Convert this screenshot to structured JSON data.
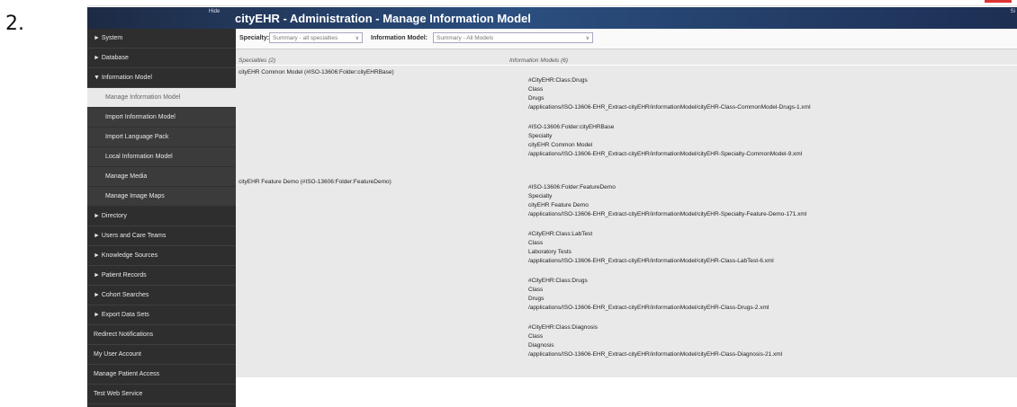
{
  "step_number": "2.",
  "header": {
    "hide_label": "Hide",
    "title": "cityEHR - Administration - Manage Information Model",
    "sign_label": "Si"
  },
  "sidebar": {
    "items": [
      "► System",
      "► Database",
      "▼ Information Model",
      "Manage Information Model",
      "Import Information Model",
      "Import Language Pack",
      "Local Information Model",
      "Manage Media",
      "Manage Image Maps",
      "► Directory",
      "► Users and Care Teams",
      "► Knowledge Sources",
      "► Patient Records",
      "► Cohort Searches",
      "► Export Data Sets",
      "Redirect Notifications",
      "My User Account",
      "Manage Patient Access",
      "Test Web Service"
    ]
  },
  "toolbar": {
    "specialty_label": "Specialty:",
    "specialty_value": "Summary - all specialties",
    "model_label": "Information Model:",
    "model_value": "Summary - All Models"
  },
  "columns": {
    "specialties": "Specialties (2)",
    "models": "Information Models (6)"
  },
  "specialties": [
    "cityEHR Common Model (#ISO-13606:Folder:cityEHRBase)",
    "cityEHR Feature Demo (#ISO-13606:Folder:FeatureDemo)"
  ],
  "models": [
    {
      "id": "#CityEHR:Class:Drugs",
      "type": "Class",
      "name": "Drugs",
      "path": "/applications/ISO-13606-EHR_Extract-cityEHR/informationModel/cityEHR-Class-CommonModel-Drugs-1.xml"
    },
    {
      "id": "#ISO-13606:Folder:cityEHRBase",
      "type": "Specialty",
      "name": "cityEHR Common Model",
      "path": "/applications/ISO-13606-EHR_Extract-cityEHR/informationModel/cityEHR-Specialty-CommonModel-9.xml"
    },
    {
      "id": "#ISO-13606:Folder:FeatureDemo",
      "type": "Specialty",
      "name": "cityEHR Feature Demo",
      "path": "/applications/ISO-13606-EHR_Extract-cityEHR/informationModel/cityEHR-Specialty-Feature-Demo-171.xml"
    },
    {
      "id": "#CityEHR:Class:LabTest",
      "type": "Class",
      "name": "Laboratory Tests",
      "path": "/applications/ISO-13606-EHR_Extract-cityEHR/informationModel/cityEHR-Class-LabTest-6.xml"
    },
    {
      "id": "#CityEHR:Class:Drugs",
      "type": "Class",
      "name": "Drugs",
      "path": "/applications/ISO-13606-EHR_Extract-cityEHR/informationModel/cityEHR-Class-Drugs-2.xml"
    },
    {
      "id": "#CityEHR:Class:Diagnosis",
      "type": "Class",
      "name": "Diagnosis",
      "path": "/applications/ISO-13606-EHR_Extract-cityEHR/informationModel/cityEHR-Class-Diagnosis-21.xml"
    }
  ]
}
